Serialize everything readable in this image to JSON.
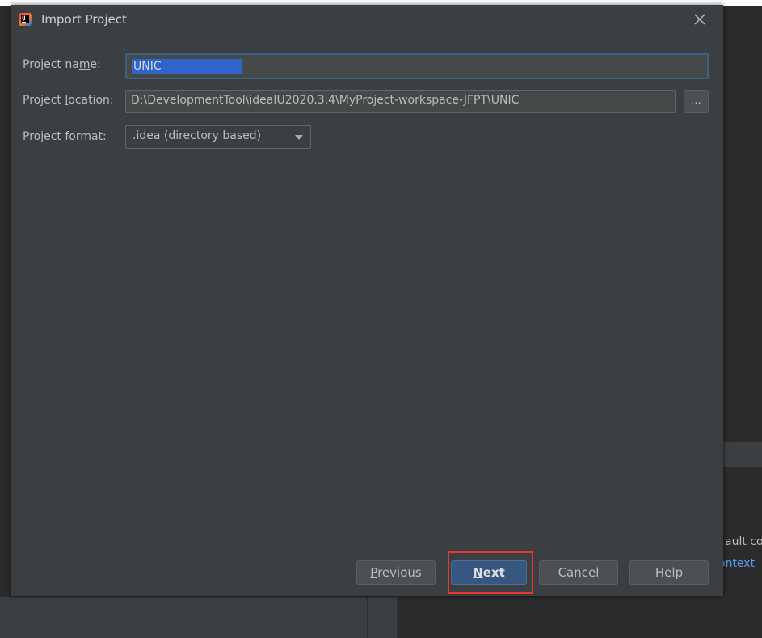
{
  "dialog": {
    "title": "Import Project",
    "fields": {
      "name_label": "Project na",
      "name_label_u": "m",
      "name_label_rest": "e:",
      "name_value": "UNIC",
      "location_label": "Project ",
      "location_label_u": "l",
      "location_label_rest": "ocation:",
      "location_value": "D:\\DevelopmentTool\\ideaIU2020.3.4\\MyProject-workspace-JFPT\\UNIC",
      "browse_label": "...",
      "format_label": "Project format:",
      "format_value": ".idea (directory based)"
    },
    "buttons": {
      "previous_u": "P",
      "previous_rest": "revious",
      "next_u": "N",
      "next_rest": "ext",
      "cancel": "Cancel",
      "help": "Help"
    }
  },
  "background": {
    "fragment_text": "ault cor",
    "fragment_link": "ontext"
  },
  "colors": {
    "dialog_bg": "#3c3f41",
    "primary_button": "#365880",
    "highlight": "#e53935",
    "selection": "#2f65ca"
  }
}
